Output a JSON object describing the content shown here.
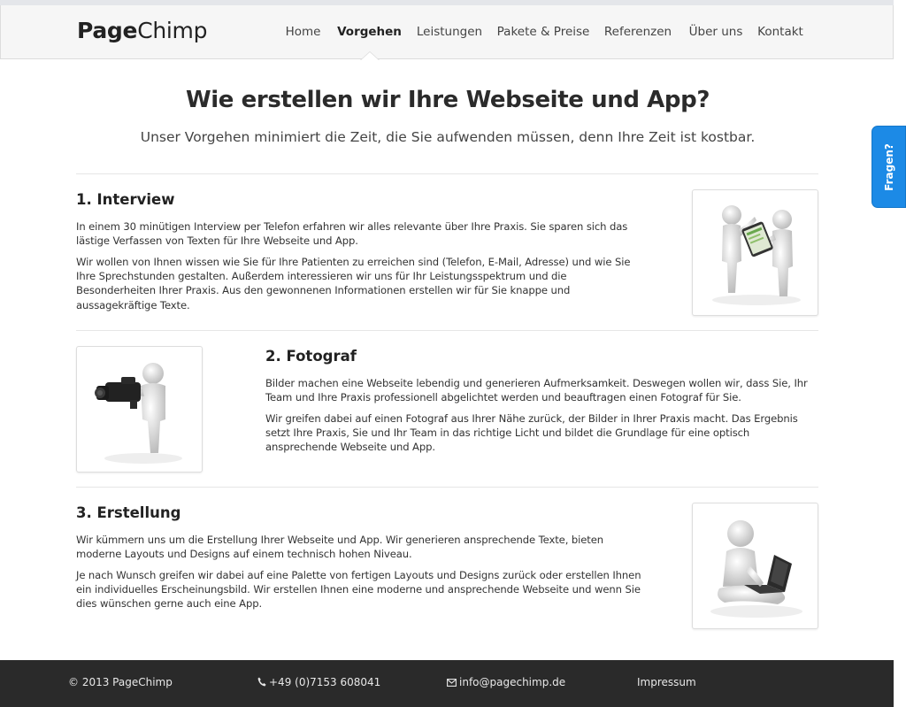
{
  "brand": {
    "bold": "Page",
    "light": "Chimp"
  },
  "nav": {
    "items": [
      {
        "label": "Home",
        "active": false
      },
      {
        "label": "Vorgehen",
        "active": true
      },
      {
        "label": "Leistungen",
        "active": false
      },
      {
        "label": "Pakete & Preise",
        "active": false
      },
      {
        "label": "Referenzen",
        "active": false
      },
      {
        "label": "Über uns",
        "active": false
      },
      {
        "label": "Kontakt",
        "active": false
      }
    ]
  },
  "header": {
    "title": "Wie erstellen wir Ihre Webseite und App?",
    "subtitle": "Unser Vorgehen minimiert die Zeit, die Sie aufwenden müssen, denn Ihre Zeit ist kostbar."
  },
  "sections": [
    {
      "title": "1. Interview",
      "paragraphs": [
        "In einem 30 minütigen Interview per Telefon erfahren wir alles relevante über Ihre Praxis. Sie sparen sich das lästige Verfassen von Texten für Ihre Webseite und App.",
        "Wir wollen von Ihnen wissen wie Sie für Ihre Patienten zu erreichen sind (Telefon, E-Mail, Adresse) und wie Sie Ihre Sprechstunden gestalten. Außerdem interessieren wir uns für Ihr Leistungsspektrum und die Besonderheiten Ihrer Praxis. Aus den gewonnenen Informationen erstellen wir für Sie knappe und aussagekräftige Texte."
      ],
      "image": "two-figures-tablet-illustration"
    },
    {
      "title": "2. Fotograf",
      "paragraphs": [
        "Bilder machen eine Webseite lebendig und generieren Aufmerksamkeit. Deswegen wollen wir, dass Sie, Ihr Team und Ihre Praxis professionell abgelichtet werden und beauftragen einen Fotograf für Sie.",
        "Wir greifen dabei auf einen Fotograf aus Ihrer Nähe zurück, der Bilder in Ihrer Praxis macht. Das Ergebnis setzt Ihre Praxis, Sie und Ihr Team in das richtige Licht und bildet die Grundlage für eine optisch ansprechende Webseite und App."
      ],
      "image": "figure-video-camera-illustration"
    },
    {
      "title": "3. Erstellung",
      "paragraphs": [
        "Wir kümmern uns um die Erstellung Ihrer Webseite und App. Wir generieren ansprechende Texte, bieten moderne Layouts und Designs auf einem technisch hohen Niveau.",
        "Je nach Wunsch greifen wir dabei auf eine Palette von fertigen Layouts und Designs zurück oder erstellen Ihnen ein individuelles Erscheinungsbild. Wir erstellen Ihnen eine moderne und ansprechende Webseite und wenn Sie dies wünschen gerne auch eine App."
      ],
      "image": "figure-laptop-illustration"
    }
  ],
  "feedback_tab": {
    "label": "Fragen?"
  },
  "footer": {
    "copyright": "© 2013 PageChimp",
    "phone": "+49 (0)7153 608041",
    "email": "info@pagechimp.de",
    "imprint": "Impressum",
    "icons": {
      "phone": "phone-icon",
      "email": "envelope-icon"
    }
  },
  "colors": {
    "accent": "#1c8ae6",
    "footer_bg": "#2a2a2a",
    "navbar_bg": "#f6f6f6"
  }
}
